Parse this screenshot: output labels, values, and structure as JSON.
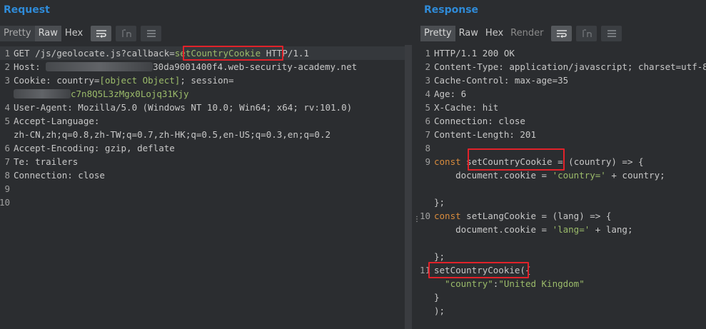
{
  "request": {
    "title": "Request",
    "tabs": [
      "Pretty",
      "Raw",
      "Hex"
    ],
    "active_tab": "Raw",
    "line_numbers": [
      "1",
      "2",
      "3",
      "4",
      "5",
      "6",
      "7",
      "8",
      "9",
      "10"
    ],
    "lines": {
      "l1_a": "GET /js/geolocate.js?callback=",
      "l1_b": "setCountryCookie",
      "l1_c": " HTTP/1.1",
      "l2_a": "Host: ",
      "l2_b": "30da9001400f4.web-security-academy.net",
      "l3_a": "Cookie: country=",
      "l3_b": "[object Object]",
      "l3_c": "; session=",
      "l3w_b": "c7n8Q5L3zMgx0Lojq31Kjy",
      "l4": "User-Agent: Mozilla/5.0 (Windows NT 10.0; Win64; x64; rv:101.0)",
      "l5": "Accept-Language:",
      "l5w": "zh-CN,zh;q=0.8,zh-TW;q=0.7,zh-HK;q=0.5,en-US;q=0.3,en;q=0.2",
      "l6": "Accept-Encoding: gzip, deflate",
      "l7": "Te: trailers",
      "l8": "Connection: close"
    }
  },
  "response": {
    "title": "Response",
    "tabs": [
      "Pretty",
      "Raw",
      "Hex",
      "Render"
    ],
    "active_tab": "Pretty",
    "lines": {
      "r1": "HTTP/1.1 200 OK",
      "r2": "Content-Type: application/javascript; charset=utf-8",
      "r3": "Cache-Control: max-age=35",
      "r4": "Age: 6",
      "r5": "X-Cache: hit",
      "r6": "Connection: close",
      "r7": "Content-Length: 201",
      "r9_kw": "const",
      "r9_name": "setCountryCookie",
      "r9_rest": " = (country) => {",
      "r9b_a": "    document.cookie = ",
      "r9b_str": "'country='",
      "r9b_rest": " + country;",
      "r9c": "};",
      "r10_kw": "const",
      "r10_rest": " setLangCookie = (lang) => {",
      "r10b_a": "    document.cookie = ",
      "r10b_str": "'lang='",
      "r10b_rest": " + lang;",
      "r10c": "};",
      "r11_name": "setCountryCookie",
      "r11_rest": "({",
      "r11b_key": "  \"country\"",
      "r11b_colon": ":",
      "r11b_val": "\"United Kingdom\"",
      "r11c": "}",
      "r11d": ");"
    }
  },
  "colors": {
    "accent": "#2f8bd8",
    "highlight_box": "#e1222a",
    "string_green": "#9bbb6a",
    "keyword_orange": "#d88b3d"
  },
  "icons": [
    "wrap-lines-icon",
    "newline-icon",
    "menu-icon"
  ]
}
